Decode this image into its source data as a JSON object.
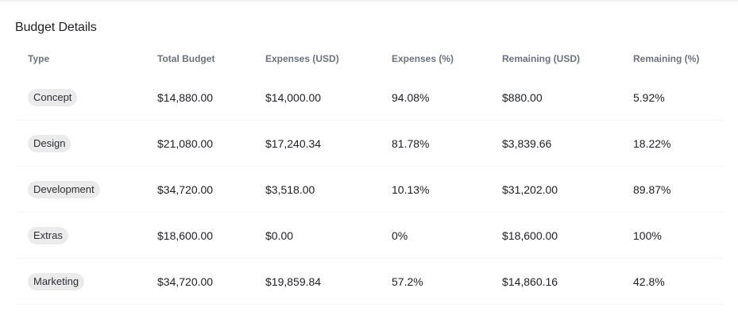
{
  "title": "Budget Details",
  "columns": [
    "Type",
    "Total Budget",
    "Expenses (USD)",
    "Expenses (%)",
    "Remaining (USD)",
    "Remaining (%)"
  ],
  "rows": [
    {
      "type": "Concept",
      "total": "$14,880.00",
      "expenses_usd": "$14,000.00",
      "expenses_pct": "94.08%",
      "remaining_usd": "$880.00",
      "remaining_pct": "5.92%"
    },
    {
      "type": "Design",
      "total": "$21,080.00",
      "expenses_usd": "$17,240.34",
      "expenses_pct": "81.78%",
      "remaining_usd": "$3,839.66",
      "remaining_pct": "18.22%"
    },
    {
      "type": "Development",
      "total": "$34,720.00",
      "expenses_usd": "$3,518.00",
      "expenses_pct": "10.13%",
      "remaining_usd": "$31,202.00",
      "remaining_pct": "89.87%"
    },
    {
      "type": "Extras",
      "total": "$18,600.00",
      "expenses_usd": "$0.00",
      "expenses_pct": "0%",
      "remaining_usd": "$18,600.00",
      "remaining_pct": "100%"
    },
    {
      "type": "Marketing",
      "total": "$34,720.00",
      "expenses_usd": "$19,859.84",
      "expenses_pct": "57.2%",
      "remaining_usd": "$14,860.16",
      "remaining_pct": "42.8%"
    }
  ]
}
